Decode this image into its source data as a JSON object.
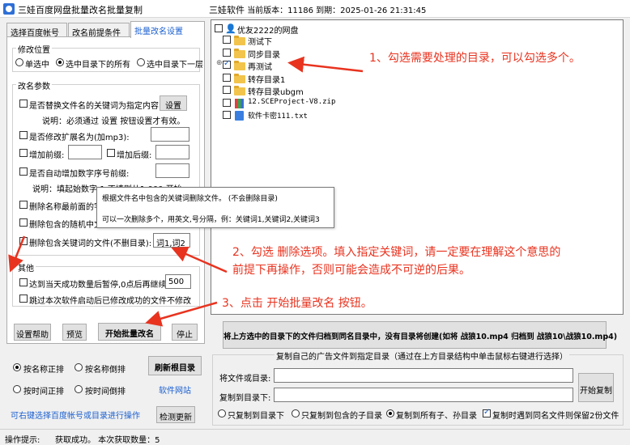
{
  "titlebar": {
    "title": "三娃百度网盘批量改名批量复制",
    "brand": "三娃软件",
    "version_info": "当前版本：11186  到期：2025-01-26 21:31:45"
  },
  "tabs": [
    {
      "label": "选择百度帐号"
    },
    {
      "label": "改名前提条件"
    },
    {
      "label": "批量改名设置"
    }
  ],
  "rename_position": {
    "group_label": "修改位置",
    "options": [
      "单选中",
      "选中目录下的所有",
      "选中目录下一层"
    ]
  },
  "rename_params": {
    "group_label": "改名参数",
    "replace_keyword": "是否替换文件名的关键词为指定内容",
    "settings_btn": "设置",
    "replace_note": "说明：必须通过  设置  按钮设置才有效。",
    "modify_ext": "是否修改扩展名为(加mp3):",
    "add_prefix": "增加前缀:",
    "add_suffix": "增加后缀:",
    "auto_seq": "是否自动增加数字序号前缀:",
    "seq_note": "说明：填起始数字:1   不填则从1 000 开始",
    "del_front": "删除名称最前面的字",
    "del_random": "删除包含的随机中文",
    "del_keyword": "删除包含关键词的文件(不删目录):",
    "del_keyword_value": "词1,词2"
  },
  "tooltip": {
    "line1": "根据文件名中包含的关键词删除文件。  (不会删除目录)",
    "line2": "可以一次删除多个，用英文,号分隔，例：关键词1,关键词2,关键词3"
  },
  "other": {
    "group_label": "其他",
    "pause_daily": "达到当天成功数量后暂停,0点后再继续",
    "pause_value": "500",
    "skip_success": "跳过本次软件启动后已修改成功的文件不修改"
  },
  "panel_buttons": {
    "help": "设置帮助",
    "preview": "预览",
    "start_rename": "开始批量改名",
    "stop": "停止"
  },
  "sort": {
    "name_asc": "按名称正排",
    "name_desc": "按名称倒排",
    "time_asc": "按时间正排",
    "time_desc": "按时间倒排",
    "refresh_btn": "刷新根目录",
    "website_link": "软件网站",
    "switch_link": "可右键选择百度帐号或目录进行操作",
    "check_update_btn": "检测更新"
  },
  "tree": {
    "root": "优友2222的网盘",
    "items": [
      {
        "name": "测试下",
        "checked": false,
        "kind": "folder"
      },
      {
        "name": "同步目录",
        "checked": false,
        "kind": "folder"
      },
      {
        "name": "再测试",
        "checked": true,
        "kind": "folder"
      },
      {
        "name": "转存目录1",
        "checked": false,
        "kind": "folder"
      },
      {
        "name": "转存目录ubgm",
        "checked": false,
        "kind": "folder"
      },
      {
        "name": "12.SCEProject-V8.zip",
        "checked": false,
        "kind": "zip"
      },
      {
        "name": "软件卡密111.txt",
        "checked": false,
        "kind": "txt"
      }
    ]
  },
  "annotations": {
    "step1": "1、勾选需要处理的目录，可以勾选多个。",
    "step2_line1": "2、勾选 删除选项。填入指定关键词，请一定要在理解这个意思的",
    "step2_line2": "前提下再操作，否则可能会造成不可逆的后果。",
    "step3": "3、点击  开始批量改名 按钮。"
  },
  "archive_btn": "将上方选中的目录下的文件归档到同名目录中，没有目录将创建(如将 战狼10.mp4 归档到 战狼10\\战狼10.mp4)",
  "copy_ad": {
    "group_label": "复制自己的广告文件到指定目录（通过在上方目录结构中单击鼠标右键进行选择）",
    "source_label": "将文件或目录:",
    "target_label": "复制到目录下:",
    "start_btn": "开始复制",
    "opt_only_dir": "只复制到目录下",
    "opt_child": "只复制到包含的子目录",
    "opt_all": "复制到所有子、孙目录",
    "keep_both": "复制时遇到同名文件则保留2份文件"
  },
  "status": {
    "label": "操作提示:",
    "message": "获取成功。  本次获取数量：5"
  },
  "colors": {
    "accent": "#1b5fcf",
    "annotation": "#e8331f",
    "folder": "#f2c44c"
  }
}
